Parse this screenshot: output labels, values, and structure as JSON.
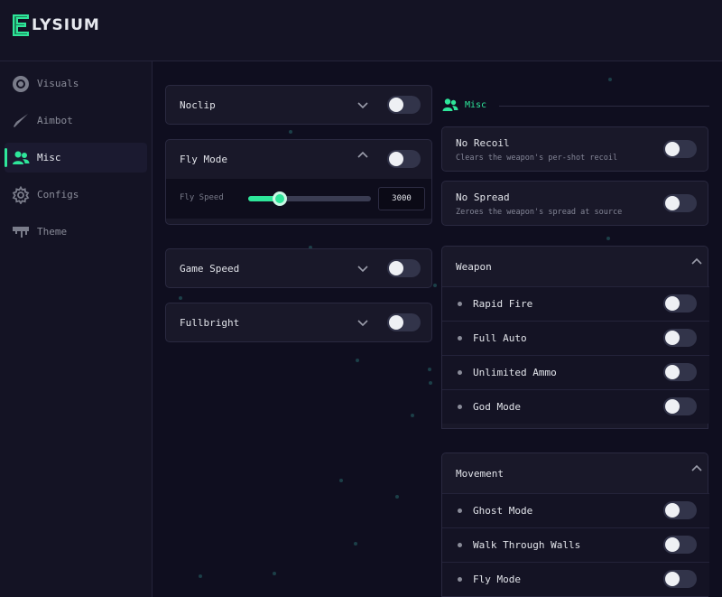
{
  "app": {
    "logo_letter": "E",
    "title": "LYSIUM",
    "accent": "#2ee69a"
  },
  "sidebar": {
    "items": [
      {
        "label": "Visuals",
        "icon": "eye-icon",
        "active": false
      },
      {
        "label": "Aimbot",
        "icon": "knife-icon",
        "active": false
      },
      {
        "label": "Misc",
        "icon": "users-icon",
        "active": true
      },
      {
        "label": "Configs",
        "icon": "gear-icon",
        "active": false
      },
      {
        "label": "Theme",
        "icon": "paint-drip-icon",
        "active": false
      }
    ]
  },
  "left": {
    "noclip": {
      "label": "Noclip",
      "enabled": false
    },
    "fly_mode": {
      "label": "Fly Mode",
      "enabled": false,
      "slider_label": "Fly Speed",
      "slider_value": "3000",
      "slider_fraction": 0.26
    },
    "game_speed": {
      "label": "Game Speed",
      "enabled": false
    },
    "fullbright": {
      "label": "Fullbright",
      "enabled": false
    }
  },
  "right": {
    "section_label": "Misc",
    "no_recoil": {
      "label": "No Recoil",
      "desc": "Clears the weapon's per-shot recoil",
      "enabled": false
    },
    "no_spread": {
      "label": "No Spread",
      "desc": "Zeroes the weapon's spread at source",
      "enabled": false
    },
    "weapon": {
      "label": "Weapon",
      "items": [
        {
          "label": "Rapid Fire",
          "enabled": false
        },
        {
          "label": "Full Auto",
          "enabled": false
        },
        {
          "label": "Unlimited Ammo",
          "enabled": false
        },
        {
          "label": "God Mode",
          "enabled": false
        }
      ]
    },
    "movement": {
      "label": "Movement",
      "items": [
        {
          "label": "Ghost Mode",
          "enabled": false
        },
        {
          "label": "Walk Through Walls",
          "enabled": false
        },
        {
          "label": "Fly Mode",
          "enabled": false
        }
      ]
    }
  }
}
